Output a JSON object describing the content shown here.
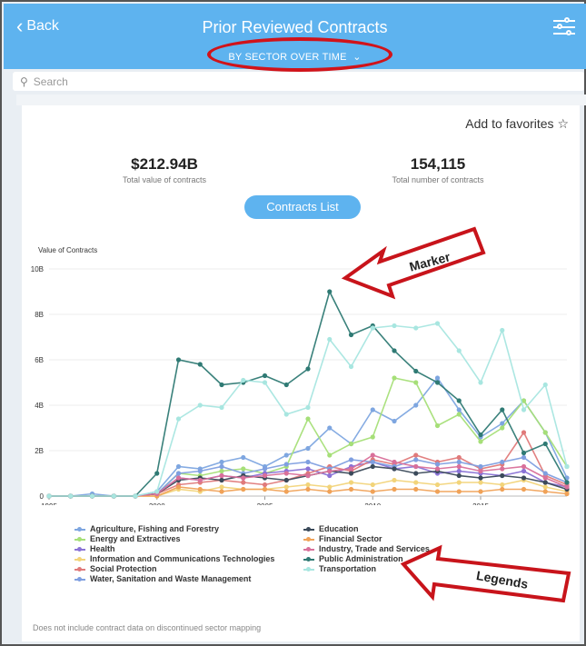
{
  "header": {
    "back_label": "Back",
    "title": "Prior Reviewed Contracts",
    "view_selector": "BY SECTOR OVER TIME"
  },
  "search": {
    "placeholder": "Search"
  },
  "favorites": {
    "label": "Add to favorites ☆"
  },
  "stats": [
    {
      "value": "$212.94B",
      "label": "Total value of contracts"
    },
    {
      "value": "154,115",
      "label": "Total number of contracts"
    }
  ],
  "contracts_list_label": "Contracts List",
  "callouts": {
    "marker": "Marker",
    "legends": "Legends"
  },
  "footnote": "Does not include contract data on discontinued sector mapping",
  "colors": {
    "accent": "#5eb3ef",
    "highlight_red": "#d1131a"
  },
  "chart_data": {
    "type": "line",
    "ylabel": "Value of Contracts",
    "ylim": [
      0,
      10
    ],
    "y_ticks": [
      "0",
      "2B",
      "4B",
      "6B",
      "8B",
      "10B"
    ],
    "x_ticks": [
      "1995",
      "2000",
      "2005",
      "2010",
      "2015"
    ],
    "x": [
      1995,
      1996,
      1997,
      1998,
      1999,
      2000,
      2001,
      2002,
      2003,
      2004,
      2005,
      2006,
      2007,
      2008,
      2009,
      2010,
      2011,
      2012,
      2013,
      2014,
      2015,
      2016,
      2017,
      2018,
      2019
    ],
    "series": [
      {
        "name": "Agriculture, Fishing and Forestry",
        "color": "#7ea6e0",
        "values": [
          0,
          0,
          0.1,
          0,
          0,
          0.2,
          1.3,
          1.2,
          1.5,
          1.7,
          1.3,
          1.8,
          2.1,
          3.0,
          2.3,
          3.8,
          3.3,
          4.0,
          5.2,
          3.8,
          2.6,
          3.2,
          4.2,
          2.8,
          0.8
        ]
      },
      {
        "name": "Energy and Extractives",
        "color": "#a6df78",
        "values": [
          0,
          0,
          0,
          0,
          0,
          0.1,
          1.0,
          0.9,
          1.1,
          1.2,
          1.0,
          1.3,
          3.4,
          1.8,
          2.3,
          2.6,
          5.2,
          5.0,
          3.1,
          3.6,
          2.4,
          3.0,
          4.2,
          2.8,
          1.3
        ]
      },
      {
        "name": "Health",
        "color": "#8a73d6",
        "values": [
          0,
          0,
          0,
          0,
          0,
          0.1,
          0.8,
          0.7,
          0.9,
          0.8,
          1.0,
          1.1,
          1.2,
          0.9,
          1.3,
          1.5,
          1.2,
          1.3,
          1.0,
          1.1,
          1.0,
          0.9,
          1.1,
          0.6,
          0.4
        ]
      },
      {
        "name": "Information and Communications Technologies",
        "color": "#f2d47a",
        "values": [
          0,
          0,
          0,
          0,
          0,
          0,
          0.3,
          0.2,
          0.4,
          0.3,
          0.3,
          0.4,
          0.5,
          0.4,
          0.6,
          0.5,
          0.7,
          0.6,
          0.5,
          0.6,
          0.6,
          0.5,
          0.7,
          0.4,
          0.2
        ]
      },
      {
        "name": "Social Protection",
        "color": "#e07a7a",
        "values": [
          0,
          0,
          0,
          0,
          0,
          0.1,
          0.5,
          0.6,
          0.7,
          0.6,
          0.5,
          0.7,
          1.0,
          1.3,
          1.1,
          1.6,
          1.4,
          1.8,
          1.5,
          1.7,
          1.2,
          1.4,
          2.8,
          0.9,
          0.5
        ]
      },
      {
        "name": "Water, Sanitation and Waste Management",
        "color": "#7f9fe0",
        "values": [
          0,
          0,
          0,
          0,
          0,
          0.1,
          1.0,
          1.1,
          1.3,
          1.0,
          1.2,
          1.4,
          1.5,
          1.2,
          1.6,
          1.5,
          1.3,
          1.6,
          1.4,
          1.5,
          1.3,
          1.5,
          1.7,
          1.0,
          0.6
        ]
      },
      {
        "name": "Education",
        "color": "#3b4a5a",
        "values": [
          0,
          0,
          0,
          0,
          0,
          0.1,
          0.7,
          0.8,
          0.7,
          0.9,
          0.8,
          0.7,
          0.9,
          1.1,
          1.0,
          1.3,
          1.2,
          1.0,
          1.1,
          0.9,
          0.8,
          0.9,
          0.8,
          0.6,
          0.3
        ]
      },
      {
        "name": "Financial Sector",
        "color": "#f0a258",
        "values": [
          0,
          0,
          0,
          0,
          0,
          0,
          0.4,
          0.3,
          0.2,
          0.3,
          0.3,
          0.2,
          0.3,
          0.2,
          0.3,
          0.2,
          0.3,
          0.3,
          0.2,
          0.2,
          0.2,
          0.3,
          0.3,
          0.2,
          0.1
        ]
      },
      {
        "name": "Industry, Trade and Services",
        "color": "#d9709a",
        "values": [
          0,
          0,
          0,
          0,
          0,
          0.1,
          0.8,
          0.7,
          0.9,
          0.8,
          0.9,
          1.0,
          0.9,
          1.1,
          1.2,
          1.8,
          1.5,
          1.3,
          1.2,
          1.3,
          1.1,
          1.2,
          1.3,
          0.8,
          0.4
        ]
      },
      {
        "name": "Public Administration",
        "color": "#2f7a74",
        "values": [
          0,
          0,
          0,
          0,
          0,
          1.0,
          6.0,
          5.8,
          4.9,
          5.0,
          5.3,
          4.9,
          5.6,
          9.0,
          7.1,
          7.5,
          6.4,
          5.5,
          5.0,
          4.2,
          2.7,
          3.8,
          1.9,
          2.3,
          0.6
        ]
      },
      {
        "name": "Transportation",
        "color": "#a8e6e0",
        "values": [
          0,
          0,
          0,
          0,
          0,
          0.2,
          3.4,
          4.0,
          3.9,
          5.1,
          5.0,
          3.6,
          3.9,
          6.9,
          5.7,
          7.4,
          7.5,
          7.4,
          7.6,
          6.4,
          5.0,
          7.3,
          3.8,
          4.9,
          1.3
        ]
      }
    ],
    "legend_position": "bottom"
  }
}
